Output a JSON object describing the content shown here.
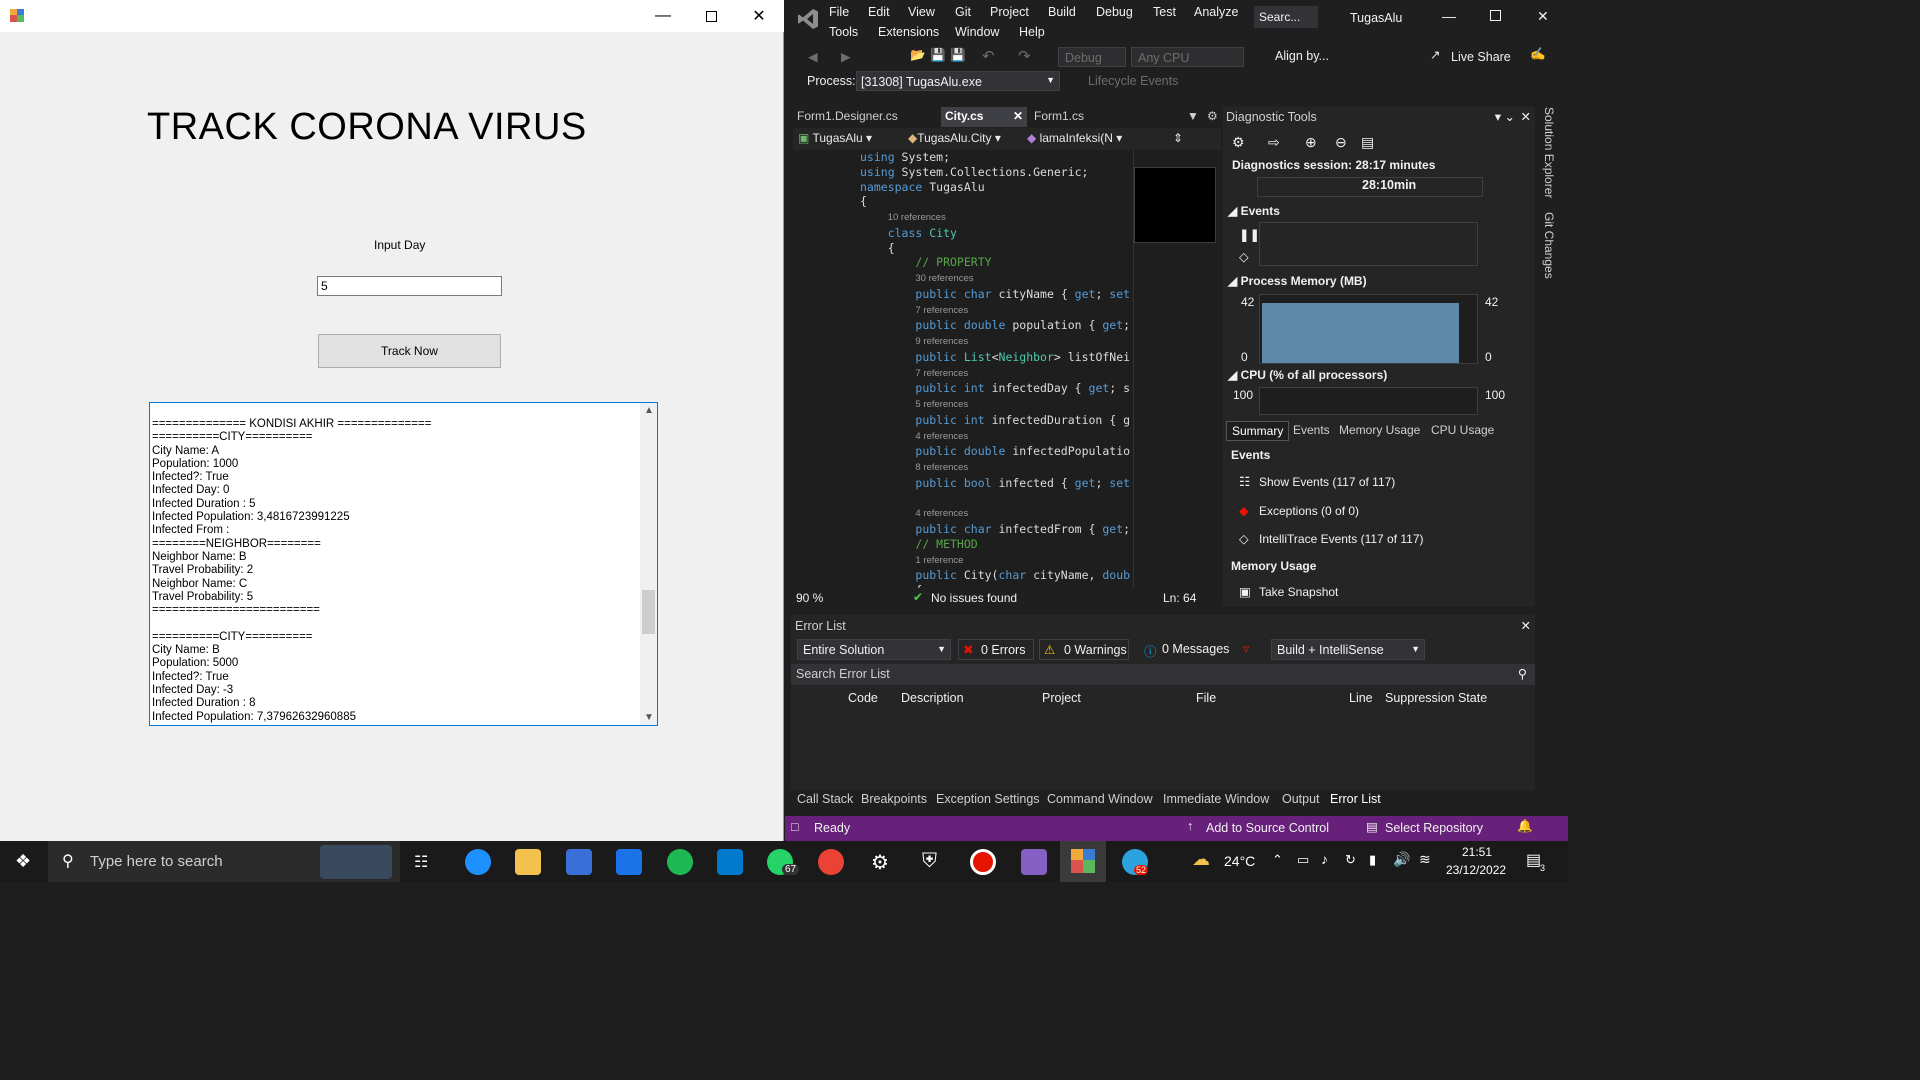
{
  "form": {
    "heading": "TRACK CORONA VIRUS",
    "input_label": "Input Day",
    "input_value": "5",
    "button_label": "Track Now",
    "result_lines": [
      "============== KONDISI AKHIR ==============",
      "==========CITY==========",
      "City Name: A",
      "Population: 1000",
      "Infected?: True",
      "Infected Day: 0",
      "Infected Duration : 5",
      "Infected Population: 3,4816723991225",
      "Infected From :",
      "========NEIGHBOR========",
      "Neighbor Name: B",
      "Travel Probability: 2",
      "Neighbor Name: C",
      "Travel Probability: 5",
      "=========================",
      "",
      "==========CITY==========",
      "City Name: B",
      "Population: 5000",
      "Infected?: True",
      "Infected Day: -3",
      "Infected Duration : 8",
      "Infected Population: 7,37962632960885"
    ]
  },
  "vs": {
    "menu": [
      "File",
      "Edit",
      "View",
      "Git",
      "Project",
      "Build",
      "Debug",
      "Test",
      "Analyze",
      "Tools",
      "Extensions",
      "Window",
      "Help"
    ],
    "search_placeholder": "Searc...",
    "solution_name": "TugasAlu",
    "toolbar": {
      "config": "Debug",
      "platform": "Any CPU",
      "align": "Align by...",
      "live_share": "Live Share"
    },
    "process_label": "Process:",
    "process_value": "[31308] TugasAlu.exe",
    "lifecycle": "Lifecycle Events",
    "editor_tabs": [
      "Form1.Designer.cs",
      "City.cs",
      "Form1.cs"
    ],
    "nav": [
      "TugasAlu",
      "TugasAlu.City",
      "lamaInfeksi(N"
    ],
    "zoom": "90 %",
    "no_issues": "No issues found",
    "line_info": "Ln: 64",
    "diag": {
      "title": "Diagnostic Tools",
      "session": "Diagnostics session: 28:17 minutes",
      "time_marker": "28:10min",
      "events_header": "Events",
      "memory_header": "Process Memory (MB)",
      "memory_top": "42",
      "memory_bottom": "0",
      "cpu_header": "CPU (% of all processors)",
      "cpu_top": "100",
      "tabs": [
        "Summary",
        "Events",
        "Memory Usage",
        "CPU Usage"
      ],
      "summary_events": "Events",
      "show_events": "Show Events (117 of 117)",
      "exceptions": "Exceptions (0 of 0)",
      "intellitrace": "IntelliTrace Events (117 of 117)",
      "memory_usage": "Memory Usage",
      "take_snapshot": "Take Snapshot"
    },
    "error_list": {
      "title": "Error List",
      "scope": "Entire Solution",
      "errors": "0 Errors",
      "warnings": "0 Warnings",
      "messages": "0 Messages",
      "build": "Build + IntelliSense",
      "search": "Search Error List",
      "columns": [
        "Code",
        "Description",
        "Project",
        "File",
        "Line",
        "Suppression State"
      ]
    },
    "bottom_tabs": [
      "Call Stack",
      "Breakpoints",
      "Exception Settings",
      "Command Window",
      "Immediate Window",
      "Output",
      "Error List"
    ],
    "status": {
      "ready": "Ready",
      "source_control": "Add to Source Control",
      "repository": "Select Repository"
    },
    "side_tabs": [
      "Solution Explorer",
      "Git Changes"
    ]
  },
  "taskbar": {
    "search_placeholder": "Type here to search",
    "weather": "24°C",
    "time": "21:51",
    "date": "23/12/2022",
    "whatsapp_badge": "67",
    "telegram_badge": "52",
    "notification_count": "3"
  }
}
